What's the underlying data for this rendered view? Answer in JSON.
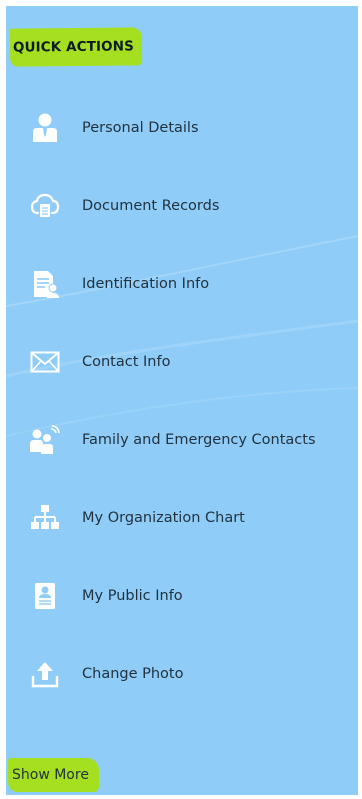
{
  "header": {
    "title": "QUICK ACTIONS"
  },
  "menu": {
    "items": [
      {
        "label": "Personal Details",
        "icon": "person-icon"
      },
      {
        "label": "Document Records",
        "icon": "cloud-document-icon"
      },
      {
        "label": "Identification Info",
        "icon": "id-document-icon"
      },
      {
        "label": "Contact Info",
        "icon": "envelope-icon"
      },
      {
        "label": "Family and Emergency Contacts",
        "icon": "family-contacts-icon"
      },
      {
        "label": "My Organization Chart",
        "icon": "org-chart-icon"
      },
      {
        "label": "My Public Info",
        "icon": "id-badge-icon"
      },
      {
        "label": "Change Photo",
        "icon": "upload-icon"
      }
    ]
  },
  "footer": {
    "show_more_label": "Show More"
  },
  "colors": {
    "panel_background": "#8fcdf8",
    "highlight": "#a4e020",
    "icon_white": "#ffffff",
    "text": "#22323f"
  }
}
